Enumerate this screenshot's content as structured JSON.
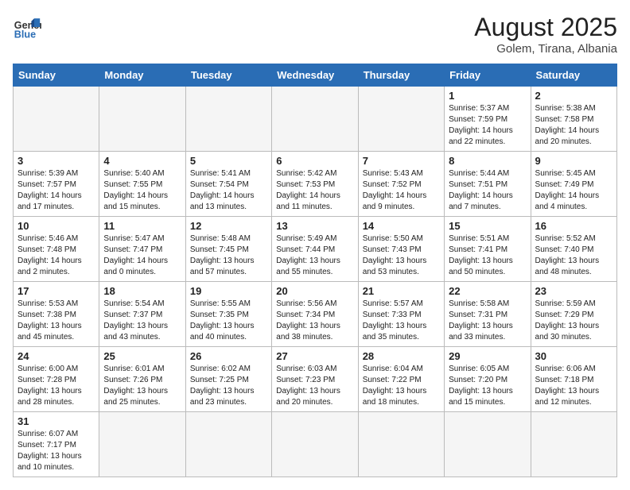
{
  "header": {
    "logo_general": "General",
    "logo_blue": "Blue",
    "title": "August 2025",
    "subtitle": "Golem, Tirana, Albania"
  },
  "days_of_week": [
    "Sunday",
    "Monday",
    "Tuesday",
    "Wednesday",
    "Thursday",
    "Friday",
    "Saturday"
  ],
  "weeks": [
    [
      {
        "day": "",
        "info": ""
      },
      {
        "day": "",
        "info": ""
      },
      {
        "day": "",
        "info": ""
      },
      {
        "day": "",
        "info": ""
      },
      {
        "day": "",
        "info": ""
      },
      {
        "day": "1",
        "info": "Sunrise: 5:37 AM\nSunset: 7:59 PM\nDaylight: 14 hours and 22 minutes."
      },
      {
        "day": "2",
        "info": "Sunrise: 5:38 AM\nSunset: 7:58 PM\nDaylight: 14 hours and 20 minutes."
      }
    ],
    [
      {
        "day": "3",
        "info": "Sunrise: 5:39 AM\nSunset: 7:57 PM\nDaylight: 14 hours and 17 minutes."
      },
      {
        "day": "4",
        "info": "Sunrise: 5:40 AM\nSunset: 7:55 PM\nDaylight: 14 hours and 15 minutes."
      },
      {
        "day": "5",
        "info": "Sunrise: 5:41 AM\nSunset: 7:54 PM\nDaylight: 14 hours and 13 minutes."
      },
      {
        "day": "6",
        "info": "Sunrise: 5:42 AM\nSunset: 7:53 PM\nDaylight: 14 hours and 11 minutes."
      },
      {
        "day": "7",
        "info": "Sunrise: 5:43 AM\nSunset: 7:52 PM\nDaylight: 14 hours and 9 minutes."
      },
      {
        "day": "8",
        "info": "Sunrise: 5:44 AM\nSunset: 7:51 PM\nDaylight: 14 hours and 7 minutes."
      },
      {
        "day": "9",
        "info": "Sunrise: 5:45 AM\nSunset: 7:49 PM\nDaylight: 14 hours and 4 minutes."
      }
    ],
    [
      {
        "day": "10",
        "info": "Sunrise: 5:46 AM\nSunset: 7:48 PM\nDaylight: 14 hours and 2 minutes."
      },
      {
        "day": "11",
        "info": "Sunrise: 5:47 AM\nSunset: 7:47 PM\nDaylight: 14 hours and 0 minutes."
      },
      {
        "day": "12",
        "info": "Sunrise: 5:48 AM\nSunset: 7:45 PM\nDaylight: 13 hours and 57 minutes."
      },
      {
        "day": "13",
        "info": "Sunrise: 5:49 AM\nSunset: 7:44 PM\nDaylight: 13 hours and 55 minutes."
      },
      {
        "day": "14",
        "info": "Sunrise: 5:50 AM\nSunset: 7:43 PM\nDaylight: 13 hours and 53 minutes."
      },
      {
        "day": "15",
        "info": "Sunrise: 5:51 AM\nSunset: 7:41 PM\nDaylight: 13 hours and 50 minutes."
      },
      {
        "day": "16",
        "info": "Sunrise: 5:52 AM\nSunset: 7:40 PM\nDaylight: 13 hours and 48 minutes."
      }
    ],
    [
      {
        "day": "17",
        "info": "Sunrise: 5:53 AM\nSunset: 7:38 PM\nDaylight: 13 hours and 45 minutes."
      },
      {
        "day": "18",
        "info": "Sunrise: 5:54 AM\nSunset: 7:37 PM\nDaylight: 13 hours and 43 minutes."
      },
      {
        "day": "19",
        "info": "Sunrise: 5:55 AM\nSunset: 7:35 PM\nDaylight: 13 hours and 40 minutes."
      },
      {
        "day": "20",
        "info": "Sunrise: 5:56 AM\nSunset: 7:34 PM\nDaylight: 13 hours and 38 minutes."
      },
      {
        "day": "21",
        "info": "Sunrise: 5:57 AM\nSunset: 7:33 PM\nDaylight: 13 hours and 35 minutes."
      },
      {
        "day": "22",
        "info": "Sunrise: 5:58 AM\nSunset: 7:31 PM\nDaylight: 13 hours and 33 minutes."
      },
      {
        "day": "23",
        "info": "Sunrise: 5:59 AM\nSunset: 7:29 PM\nDaylight: 13 hours and 30 minutes."
      }
    ],
    [
      {
        "day": "24",
        "info": "Sunrise: 6:00 AM\nSunset: 7:28 PM\nDaylight: 13 hours and 28 minutes."
      },
      {
        "day": "25",
        "info": "Sunrise: 6:01 AM\nSunset: 7:26 PM\nDaylight: 13 hours and 25 minutes."
      },
      {
        "day": "26",
        "info": "Sunrise: 6:02 AM\nSunset: 7:25 PM\nDaylight: 13 hours and 23 minutes."
      },
      {
        "day": "27",
        "info": "Sunrise: 6:03 AM\nSunset: 7:23 PM\nDaylight: 13 hours and 20 minutes."
      },
      {
        "day": "28",
        "info": "Sunrise: 6:04 AM\nSunset: 7:22 PM\nDaylight: 13 hours and 18 minutes."
      },
      {
        "day": "29",
        "info": "Sunrise: 6:05 AM\nSunset: 7:20 PM\nDaylight: 13 hours and 15 minutes."
      },
      {
        "day": "30",
        "info": "Sunrise: 6:06 AM\nSunset: 7:18 PM\nDaylight: 13 hours and 12 minutes."
      }
    ],
    [
      {
        "day": "31",
        "info": "Sunrise: 6:07 AM\nSunset: 7:17 PM\nDaylight: 13 hours and 10 minutes."
      },
      {
        "day": "",
        "info": ""
      },
      {
        "day": "",
        "info": ""
      },
      {
        "day": "",
        "info": ""
      },
      {
        "day": "",
        "info": ""
      },
      {
        "day": "",
        "info": ""
      },
      {
        "day": "",
        "info": ""
      }
    ]
  ]
}
